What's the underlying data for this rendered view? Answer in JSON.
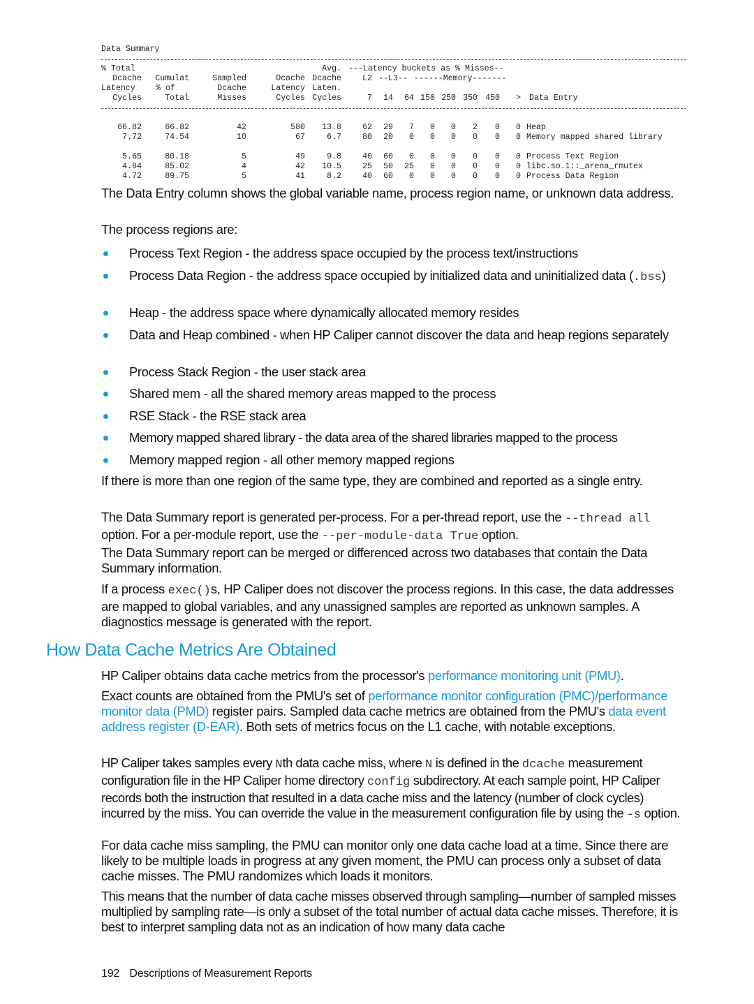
{
  "summary": {
    "title": "Data Summary",
    "header_rows": [
      [
        "% Total",
        "",
        "",
        "",
        "Avg.",
        "---Latency buckets as % Misses--",
        "",
        ""
      ],
      [
        "Dcache",
        "Cumulat",
        "Sampled",
        "Dcache",
        "Dcache",
        "L2",
        "--L3--",
        "------Memory-------"
      ],
      [
        "Latency",
        "% of",
        "Dcache",
        "Latency",
        "Laten.",
        "",
        "",
        ""
      ],
      [
        "Cycles",
        "Total",
        "Misses",
        "Cycles",
        "Cycles",
        "",
        "",
        ""
      ]
    ],
    "bucket_labels": [
      "7",
      "14",
      "64",
      "150",
      "250",
      "350",
      "450",
      ">"
    ],
    "data_entry_label": "Data Entry",
    "rows": [
      {
        "pct_total": "66.82",
        "cumulat": "66.82",
        "sampled": "42",
        "latency": "580",
        "avg": "13.8",
        "buckets": [
          "62",
          "29",
          "7",
          "0",
          "0",
          "2",
          "0",
          "0"
        ],
        "entry": "Heap"
      },
      {
        "pct_total": "7.72",
        "cumulat": "74.54",
        "sampled": "10",
        "latency": "67",
        "avg": "6.7",
        "buckets": [
          "80",
          "20",
          "0",
          "0",
          "0",
          "0",
          "0",
          "0"
        ],
        "entry": "Memory mapped shared library"
      },
      {
        "pct_total": "5.65",
        "cumulat": "80.18",
        "sampled": "5",
        "latency": "49",
        "avg": "9.8",
        "buckets": [
          "40",
          "60",
          "0",
          "0",
          "0",
          "0",
          "0",
          "0"
        ],
        "entry": "Process Text Region"
      },
      {
        "pct_total": "4.84",
        "cumulat": "85.02",
        "sampled": "4",
        "latency": "42",
        "avg": "10.5",
        "buckets": [
          "25",
          "50",
          "25",
          "0",
          "0",
          "0",
          "0",
          "0"
        ],
        "entry": "libc.so.1::_arena_rmutex"
      },
      {
        "pct_total": "4.72",
        "cumulat": "89.75",
        "sampled": "5",
        "latency": "41",
        "avg": "8.2",
        "buckets": [
          "40",
          "60",
          "0",
          "0",
          "0",
          "0",
          "0",
          "0"
        ],
        "entry": "Process Data Region"
      }
    ]
  },
  "para_data_entry": "The Data Entry column shows the global variable name, process region name, or unknown data address.",
  "para_regions_intro": "The process regions are:",
  "regions": [
    {
      "text": "Process Text Region - the address space occupied by the process text/instructions"
    },
    {
      "text": "Process Data Region - the address space occupied by initialized data and uninitialized data (",
      "code": ".bss",
      "after": ")"
    },
    {
      "text": "Heap - the address space where dynamically allocated memory resides"
    },
    {
      "text": "Data and Heap combined - when HP Caliper cannot discover the data and heap regions separately"
    },
    {
      "text": "Process Stack Region - the user stack area"
    },
    {
      "text": "Shared mem - all the shared memory areas mapped to the process"
    },
    {
      "text": "RSE Stack - the RSE stack area"
    },
    {
      "text": "Memory mapped shared library - the data area of the shared libraries mapped to the process"
    },
    {
      "text": "Memory mapped region - all other memory mapped regions"
    }
  ],
  "para_combined": "If there is more than one region of the same type, they are combined and reported as a single entry.",
  "para_per_process": {
    "t1": "The Data Summary report is generated per-process. For a per-thread report, use the ",
    "c1": "--thread all",
    "t2": " option. For a per-module report, use the ",
    "c2": "--per-module-data True",
    "t3": " option."
  },
  "para_merged": "The Data Summary report can be merged or differenced across two databases that contain the Data Summary information.",
  "para_exec": {
    "t1": "If a process ",
    "c1": "exec()",
    "t2": "s, HP Caliper does not discover the process regions. In this case, the data addresses are mapped to global variables, and any unassigned samples are reported as unknown samples. A diagnostics message is generated with the report."
  },
  "section_heading": "How Data Cache Metrics Are Obtained",
  "para_pmu": {
    "t1": "HP Caliper obtains data cache metrics from the processor's ",
    "link1": "performance monitoring unit (PMU)",
    "t2": "."
  },
  "para_exact": {
    "t1": "Exact counts are obtained from the PMU's set of ",
    "link1": "performance monitor configuration (PMC)/performance monitor data (PMD)",
    "t2": " register pairs. Sampled data cache metrics are obtained from the PMU's ",
    "link2": "data event address register (D-EAR)",
    "t3": ". Both sets of metrics focus on the L1 cache, with notable exceptions."
  },
  "para_samples": {
    "t1": "HP Caliper takes samples every ",
    "c1": "N",
    "t2": "th data cache miss, where ",
    "c2": "N",
    "t3": " is defined in the ",
    "c3": "dcache",
    "t4": " measurement configuration file in the HP Caliper home directory ",
    "c4": "config",
    "t5": " subdirectory. At each sample point, HP Caliper records both the instruction that resulted in a data cache miss and the latency (number of clock cycles) incurred by the miss. You can override the value in the measurement configuration file by using the ",
    "c5": "-s",
    "t6": " option."
  },
  "para_sampling": "For data cache miss sampling, the PMU can monitor only one data cache load at a time. Since there are likely to be multiple loads in progress at any given moment, the PMU can process only a subset of data cache misses. The PMU randomizes which loads it monitors.",
  "para_means": "This means that the number of data cache misses observed through sampling—number of sampled misses multiplied by sampling rate—is only a subset of the total number of actual data cache misses. Therefore, it is best to interpret sampling data not as an indication of how many data cache",
  "footer": {
    "page_number": "192",
    "section": "Descriptions of Measurement Reports"
  },
  "colors": {
    "accent": "#1a9bd2",
    "text": "#111111"
  }
}
